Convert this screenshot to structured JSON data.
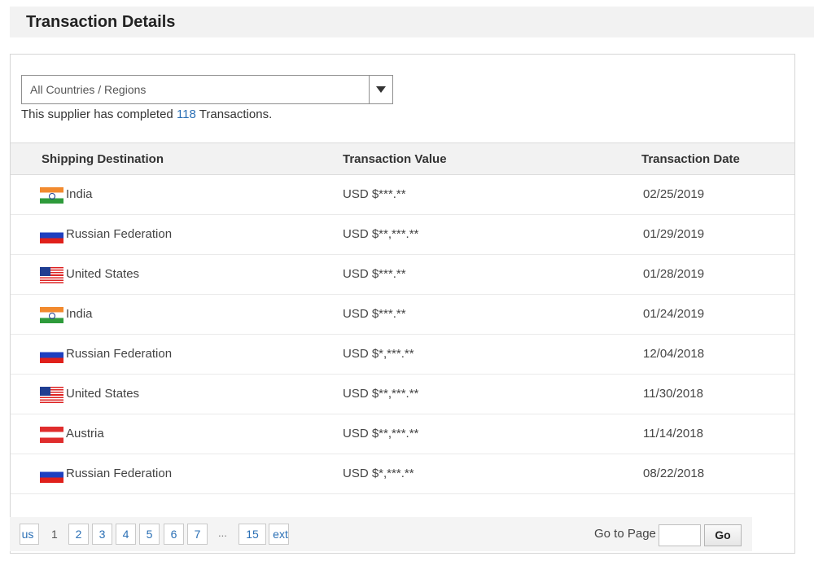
{
  "header": {
    "title": "Transaction Details"
  },
  "filter": {
    "selected": "All Countries / Regions"
  },
  "summary": {
    "prefix": "This supplier has completed ",
    "count": "118",
    "suffix": " Transactions."
  },
  "table": {
    "columns": [
      "Shipping Destination",
      "Transaction Value",
      "Transaction Date"
    ],
    "rows": [
      {
        "flag": "india-flag-icon",
        "destination": "India",
        "value": "USD $***.**",
        "date": "02/25/2019"
      },
      {
        "flag": "russia-flag-icon",
        "destination": "Russian Federation",
        "value": "USD $**,***.**",
        "date": "01/29/2019"
      },
      {
        "flag": "usa-flag-icon",
        "destination": "United States",
        "value": "USD $***.**",
        "date": "01/28/2019"
      },
      {
        "flag": "india-flag-icon",
        "destination": "India",
        "value": "USD $***.**",
        "date": "01/24/2019"
      },
      {
        "flag": "russia-flag-icon",
        "destination": "Russian Federation",
        "value": "USD $*,***.**",
        "date": "12/04/2018"
      },
      {
        "flag": "usa-flag-icon",
        "destination": "United States",
        "value": "USD $**,***.**",
        "date": "11/30/2018"
      },
      {
        "flag": "austria-flag-icon",
        "destination": "Austria",
        "value": "USD $**,***.**",
        "date": "11/14/2018"
      },
      {
        "flag": "russia-flag-icon",
        "destination": "Russian Federation",
        "value": "USD $*,***.**",
        "date": "08/22/2018"
      }
    ]
  },
  "pagination": {
    "previous_label": "us",
    "current_page": "1",
    "pages": [
      "2",
      "3",
      "4",
      "5",
      "6",
      "7"
    ],
    "ellipsis": "...",
    "last_page": "15",
    "next_label": "ext",
    "goto_label": "Go to Page",
    "goto_value": "",
    "go_label": "Go"
  },
  "colors": {
    "link": "#2a6fb5",
    "header_bg": "#f2f2f2"
  }
}
